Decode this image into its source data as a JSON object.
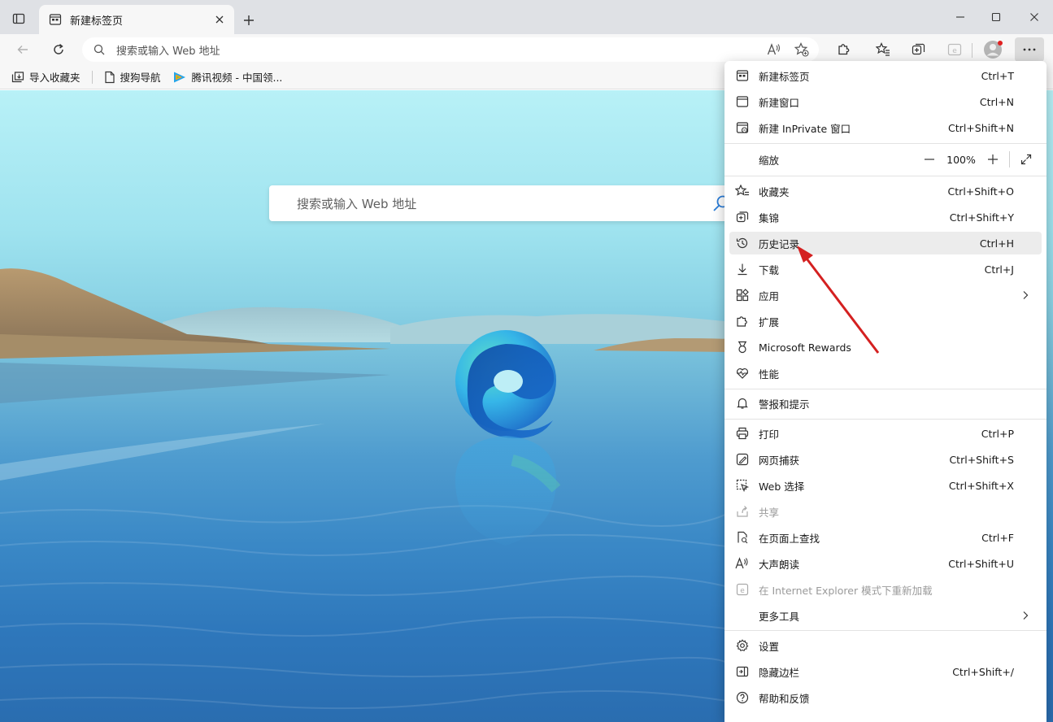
{
  "tab": {
    "title": "新建标签页"
  },
  "address": {
    "placeholder": "搜索或输入 Web 地址"
  },
  "bookmarks": [
    {
      "label": "导入收藏夹"
    },
    {
      "label": "搜狗导航"
    },
    {
      "label": "腾讯视频 - 中国领..."
    }
  ],
  "ntp": {
    "search_placeholder": "搜索或输入 Web 地址"
  },
  "menu": {
    "new_tab": {
      "label": "新建标签页",
      "shortcut": "Ctrl+T"
    },
    "new_window": {
      "label": "新建窗口",
      "shortcut": "Ctrl+N"
    },
    "new_inprivate": {
      "label": "新建 InPrivate 窗口",
      "shortcut": "Ctrl+Shift+N"
    },
    "zoom": {
      "label": "缩放",
      "value": "100%"
    },
    "favorites": {
      "label": "收藏夹",
      "shortcut": "Ctrl+Shift+O"
    },
    "collections": {
      "label": "集锦",
      "shortcut": "Ctrl+Shift+Y"
    },
    "history": {
      "label": "历史记录",
      "shortcut": "Ctrl+H"
    },
    "downloads": {
      "label": "下载",
      "shortcut": "Ctrl+J"
    },
    "apps": {
      "label": "应用"
    },
    "extensions": {
      "label": "扩展"
    },
    "rewards": {
      "label": "Microsoft Rewards"
    },
    "performance": {
      "label": "性能"
    },
    "alerts": {
      "label": "警报和提示"
    },
    "print": {
      "label": "打印",
      "shortcut": "Ctrl+P"
    },
    "web_capture": {
      "label": "网页捕获",
      "shortcut": "Ctrl+Shift+S"
    },
    "web_select": {
      "label": "Web 选择",
      "shortcut": "Ctrl+Shift+X"
    },
    "share": {
      "label": "共享"
    },
    "find": {
      "label": "在页面上查找",
      "shortcut": "Ctrl+F"
    },
    "read_aloud": {
      "label": "大声朗读",
      "shortcut": "Ctrl+Shift+U"
    },
    "ie_mode": {
      "label": "在 Internet Explorer 模式下重新加载"
    },
    "more_tools": {
      "label": "更多工具"
    },
    "settings": {
      "label": "设置"
    },
    "hide_sidebar": {
      "label": "隐藏边栏",
      "shortcut": "Ctrl+Shift+/"
    },
    "help": {
      "label": "帮助和反馈"
    }
  },
  "colors": {
    "annotation_arrow": "#d42020",
    "menu_hover": "#ececec",
    "titlebar": "#dfe1e5"
  }
}
